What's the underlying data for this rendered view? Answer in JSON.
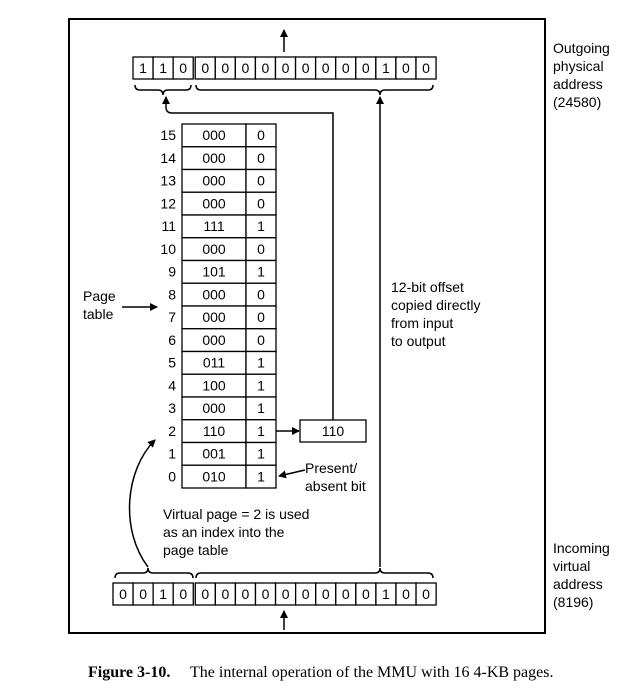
{
  "outgoing": {
    "bits": [
      "1",
      "1",
      "0",
      "0",
      "0",
      "0",
      "0",
      "0",
      "0",
      "0",
      "0",
      "0",
      "1",
      "0",
      "0"
    ],
    "label": [
      "Outgoing",
      "physical",
      "address",
      "(24580)"
    ]
  },
  "incoming": {
    "bits": [
      "0",
      "0",
      "1",
      "0",
      "0",
      "0",
      "0",
      "0",
      "0",
      "0",
      "0",
      "0",
      "0",
      "1",
      "0",
      "0"
    ],
    "label": [
      "Incoming",
      "virtual",
      "address",
      "(8196)"
    ]
  },
  "page_table": {
    "label": [
      "Page",
      "table"
    ],
    "rows": [
      {
        "index": "15",
        "frame": "000",
        "present": "0"
      },
      {
        "index": "14",
        "frame": "000",
        "present": "0"
      },
      {
        "index": "13",
        "frame": "000",
        "present": "0"
      },
      {
        "index": "12",
        "frame": "000",
        "present": "0"
      },
      {
        "index": "11",
        "frame": "111",
        "present": "1"
      },
      {
        "index": "10",
        "frame": "000",
        "present": "0"
      },
      {
        "index": "9",
        "frame": "101",
        "present": "1"
      },
      {
        "index": "8",
        "frame": "000",
        "present": "0"
      },
      {
        "index": "7",
        "frame": "000",
        "present": "0"
      },
      {
        "index": "6",
        "frame": "000",
        "present": "0"
      },
      {
        "index": "5",
        "frame": "011",
        "present": "1"
      },
      {
        "index": "4",
        "frame": "100",
        "present": "1"
      },
      {
        "index": "3",
        "frame": "000",
        "present": "1"
      },
      {
        "index": "2",
        "frame": "110",
        "present": "1"
      },
      {
        "index": "1",
        "frame": "001",
        "present": "1"
      },
      {
        "index": "0",
        "frame": "010",
        "present": "1"
      }
    ]
  },
  "selected_frame": "110",
  "present_label": [
    "Present/",
    "absent bit"
  ],
  "offset_note": [
    "12-bit offset",
    "copied directly",
    "from input",
    "to output"
  ],
  "index_note": [
    "Virtual page = 2 is used",
    "as an index into the",
    "page table"
  ],
  "caption": {
    "number": "Figure 3-10.",
    "text": "The internal operation of the MMU with 16 4-KB pages."
  }
}
